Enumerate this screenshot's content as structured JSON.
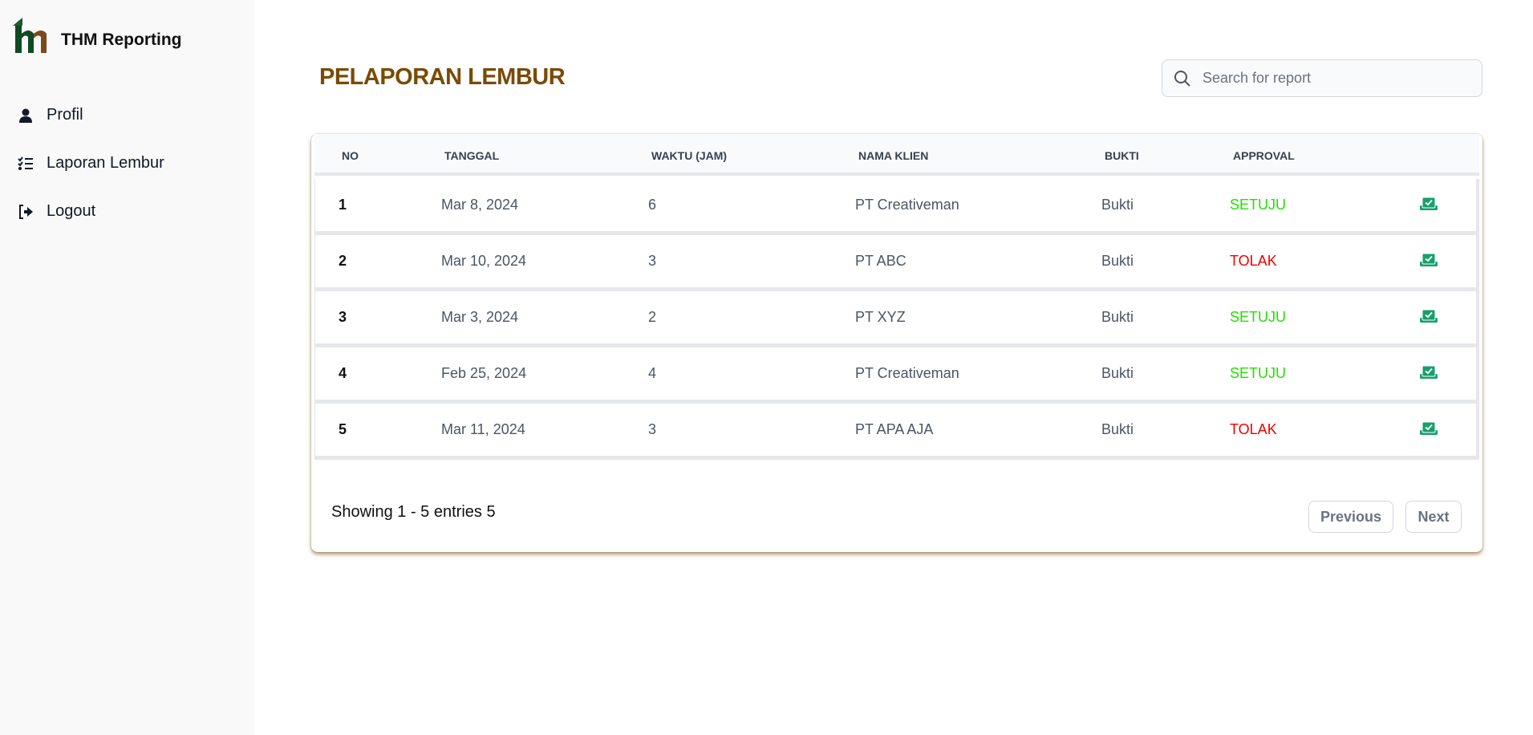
{
  "app": {
    "name": "THM Reporting"
  },
  "sidebar": {
    "items": [
      {
        "label": "Profil",
        "icon": "user-icon"
      },
      {
        "label": "Laporan Lembur",
        "icon": "list-check-icon"
      },
      {
        "label": "Logout",
        "icon": "logout-icon"
      }
    ]
  },
  "page": {
    "title": "PELAPORAN LEMBUR"
  },
  "search": {
    "placeholder": "Search for report",
    "value": ""
  },
  "table": {
    "headers": [
      "NO",
      "TANGGAL",
      "WAKTU (JAM)",
      "NAMA KLIEN",
      "BUKTI",
      "APPROVAL"
    ],
    "rows": [
      {
        "no": "1",
        "tanggal": "Mar 8, 2024",
        "waktu": "6",
        "klien": "PT Creativeman",
        "bukti": "Bukti",
        "approval": "SETUJU"
      },
      {
        "no": "2",
        "tanggal": "Mar 10, 2024",
        "waktu": "3",
        "klien": "PT ABC",
        "bukti": "Bukti",
        "approval": "TOLAK"
      },
      {
        "no": "3",
        "tanggal": "Mar 3, 2024",
        "waktu": "2",
        "klien": "PT XYZ",
        "bukti": "Bukti",
        "approval": "SETUJU"
      },
      {
        "no": "4",
        "tanggal": "Feb 25, 2024",
        "waktu": "4",
        "klien": "PT Creativeman",
        "bukti": "Bukti",
        "approval": "SETUJU"
      },
      {
        "no": "5",
        "tanggal": "Mar 11, 2024",
        "waktu": "3",
        "klien": "PT APA AJA",
        "bukti": "Bukti",
        "approval": "TOLAK"
      }
    ]
  },
  "footer": {
    "showing": "Showing 1 - 5 entries 5",
    "previous": "Previous",
    "next": "Next"
  },
  "colors": {
    "title": "#7a4a06",
    "approved": "#22e000",
    "rejected": "#e00000",
    "action_icon": "#16a06a"
  }
}
